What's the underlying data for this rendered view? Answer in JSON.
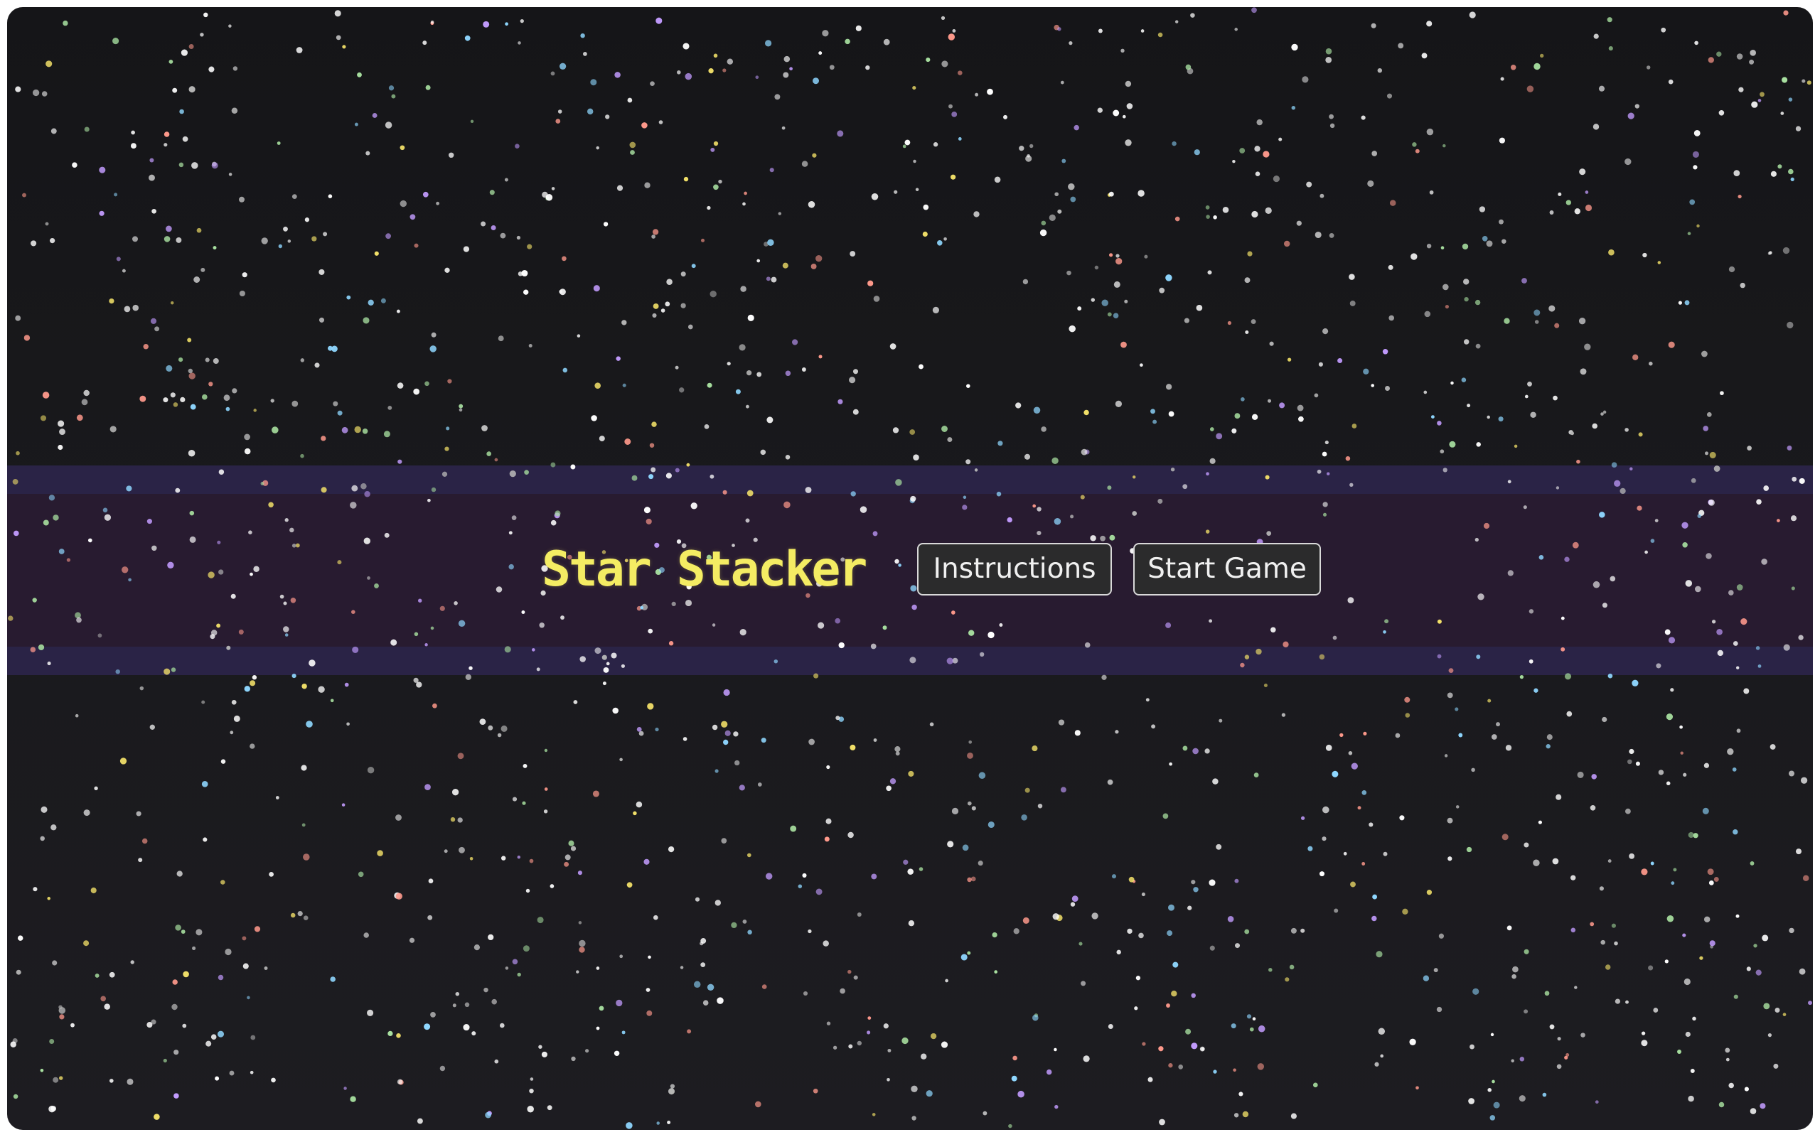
{
  "game": {
    "title": "Star Stacker"
  },
  "menu": {
    "instructions_label": "Instructions",
    "start_label": "Start Game"
  },
  "theme": {
    "title_color": "#f4ec63",
    "button_border": "#d9d9d9",
    "button_background": "#2b2b2c",
    "band_color": "#281b30",
    "band_edge_color": "#2a2346",
    "star_colors": [
      "#ffffff",
      "#ffffff",
      "#ffffff",
      "#ffffff",
      "#e6e6e6",
      "#b5b5b5",
      "#c39cff",
      "#f5e36a",
      "#8fd7ff",
      "#ff9a8c",
      "#a8e0a0"
    ]
  }
}
